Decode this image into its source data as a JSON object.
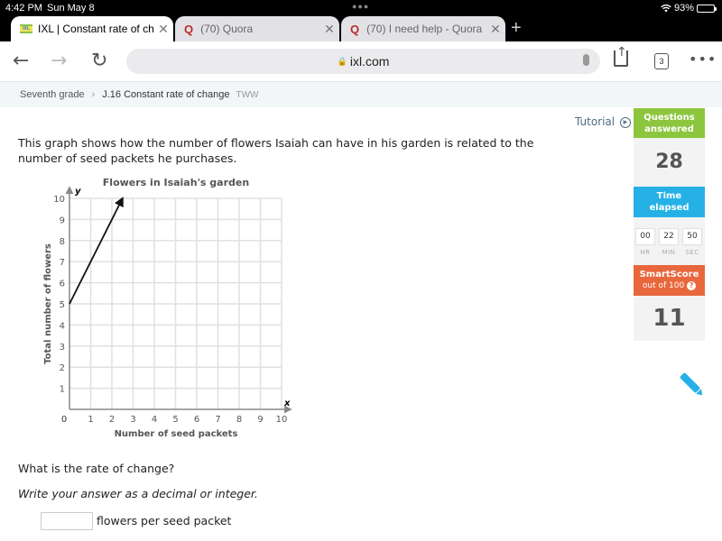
{
  "status_bar": {
    "time": "4:42 PM",
    "date": "Sun May 8",
    "battery": "93%"
  },
  "browser": {
    "tabs": [
      {
        "title": "IXL | Constant rate of cha",
        "icon": "ixl-favicon",
        "active": true
      },
      {
        "title": "(70) Quora",
        "icon": "quora-favicon",
        "active": false
      },
      {
        "title": "(70) I need help - Quora",
        "icon": "quora-favicon",
        "active": false
      }
    ],
    "url": "ixl.com",
    "tab_count": "3"
  },
  "breadcrumb": {
    "grade": "Seventh grade",
    "skill": "J.16 Constant rate of change",
    "code": "TWW"
  },
  "sidebar": {
    "tutorial": "Tutorial",
    "questions_answered_label_1": "Questions",
    "questions_answered_label_2": "answered",
    "questions_answered": "28",
    "time_elapsed_label_1": "Time",
    "time_elapsed_label_2": "elapsed",
    "time": {
      "hr": "00",
      "min": "22",
      "sec": "50",
      "hr_label": "HR",
      "min_label": "MIN",
      "sec_label": "SEC"
    },
    "smartscore_label": "SmartScore",
    "smartscore_sub": "out of 100",
    "smartscore": "11",
    "accent": {
      "green": "#8cc63e",
      "blue": "#26b1e6",
      "orange": "#e8673c"
    }
  },
  "question": {
    "text": "This graph shows how the number of flowers Isaiah can have in his garden is related to the number of seed packets he purchases.",
    "prompt": "What is the rate of change?",
    "instruction": "Write your answer as a decimal or integer.",
    "answer_value": "",
    "unit": "flowers per seed packet"
  },
  "chart_data": {
    "type": "line",
    "title": "Flowers in Isaiah's garden",
    "xlabel": "Number of seed packets",
    "ylabel": "Total number of flowers",
    "x_axis_letter": "x",
    "y_axis_letter": "y",
    "xlim": [
      0,
      10
    ],
    "ylim": [
      0,
      10
    ],
    "x_ticks": [
      "1",
      "2",
      "3",
      "4",
      "5",
      "6",
      "7",
      "8",
      "9",
      "10"
    ],
    "y_ticks": [
      "1",
      "2",
      "3",
      "4",
      "5",
      "6",
      "7",
      "8",
      "9",
      "10"
    ],
    "origin_label": "0",
    "grid": true,
    "series": [
      {
        "name": "flowers",
        "points": [
          [
            0,
            5
          ],
          [
            2.5,
            10
          ]
        ],
        "arrow_end": true
      }
    ]
  }
}
